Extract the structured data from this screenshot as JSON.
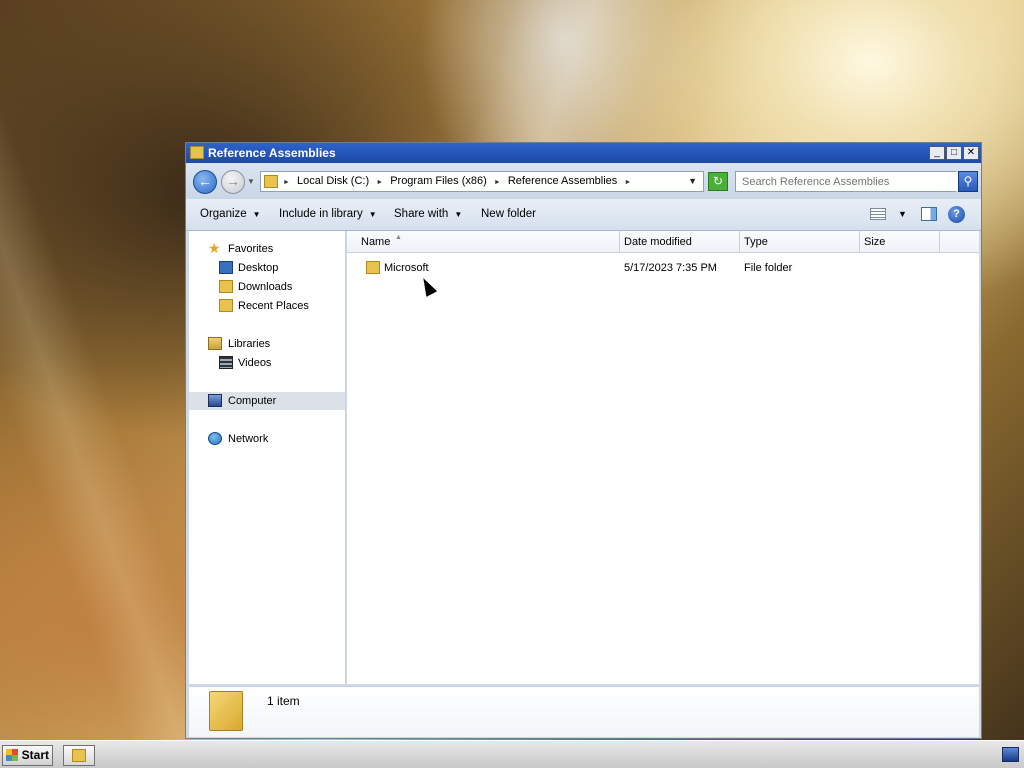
{
  "window": {
    "title": "Reference Assemblies",
    "caption_buttons": {
      "minimize": "_",
      "maximize": "□",
      "close": "✕"
    }
  },
  "address_bar": {
    "crumbs": [
      "Local Disk (C:)",
      "Program Files (x86)",
      "Reference Assemblies"
    ],
    "search_placeholder": "Search Reference Assemblies"
  },
  "toolbar": {
    "organize": "Organize",
    "include_in_library": "Include in library",
    "share_with": "Share with",
    "new_folder": "New folder"
  },
  "nav_pane": {
    "favorites": "Favorites",
    "desktop": "Desktop",
    "downloads": "Downloads",
    "recent_places": "Recent Places",
    "libraries": "Libraries",
    "videos": "Videos",
    "computer": "Computer",
    "network": "Network"
  },
  "columns": {
    "name": "Name",
    "date_modified": "Date modified",
    "type": "Type",
    "size": "Size"
  },
  "files": [
    {
      "name": "Microsoft",
      "date_modified": "5/17/2023 7:35 PM",
      "type": "File folder",
      "size": ""
    }
  ],
  "details": {
    "item_count": "1 item"
  },
  "taskbar": {
    "start": "Start"
  },
  "colors": {
    "titlebar": "#2f63c9",
    "folder": "#e8c24c",
    "selection": "#dde2e8"
  }
}
